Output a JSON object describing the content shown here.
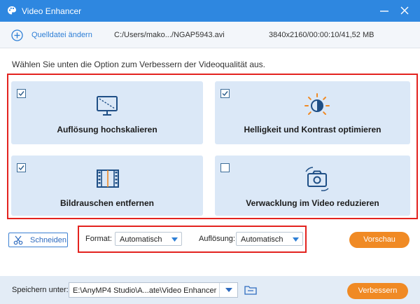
{
  "window": {
    "title": "Video Enhancer",
    "icons": {
      "app": "palette-icon",
      "minimize": "minimize-icon",
      "close": "close-icon"
    }
  },
  "source": {
    "add_label": "Quelldatei ändern",
    "add_icon": "plus-circle-icon",
    "path": "C:/Users/mako.../NGAP5943.avi",
    "meta": "3840x2160/00:00:10/41,52 MB"
  },
  "instruction": "Wählen Sie unten die Option zum Verbessern der Videoqualität aus.",
  "options": [
    {
      "label": "Auflösung hochskalieren",
      "checked": true,
      "icon": "monitor-upscale-icon"
    },
    {
      "label": "Helligkeit und Kontrast optimieren",
      "checked": true,
      "icon": "brightness-icon"
    },
    {
      "label": "Bildrauschen entfernen",
      "checked": true,
      "icon": "film-denoise-icon"
    },
    {
      "label": "Verwacklung im Video reduzieren",
      "checked": false,
      "icon": "camera-shake-icon"
    }
  ],
  "toolbar": {
    "cut_label": "Schneiden",
    "cut_icon": "scissors-icon",
    "format_label": "Format:",
    "format_value": "Automatisch",
    "resolution_label": "Auflösung:",
    "resolution_value": "Automatisch",
    "preview_label": "Vorschau"
  },
  "footer": {
    "save_label": "Speichern unter:",
    "save_path": "E:\\AnyMP4 Studio\\A...ate\\Video Enhancer",
    "folder_icon": "folder-icon",
    "enhance_label": "Verbessern"
  },
  "colors": {
    "titlebar": "#2e87e0",
    "card_bg": "#dbe8f7",
    "highlight_frame": "#e3231f",
    "accent_orange": "#f08a24",
    "icon_blue": "#1f4f86",
    "link_blue": "#2e7fd6"
  }
}
